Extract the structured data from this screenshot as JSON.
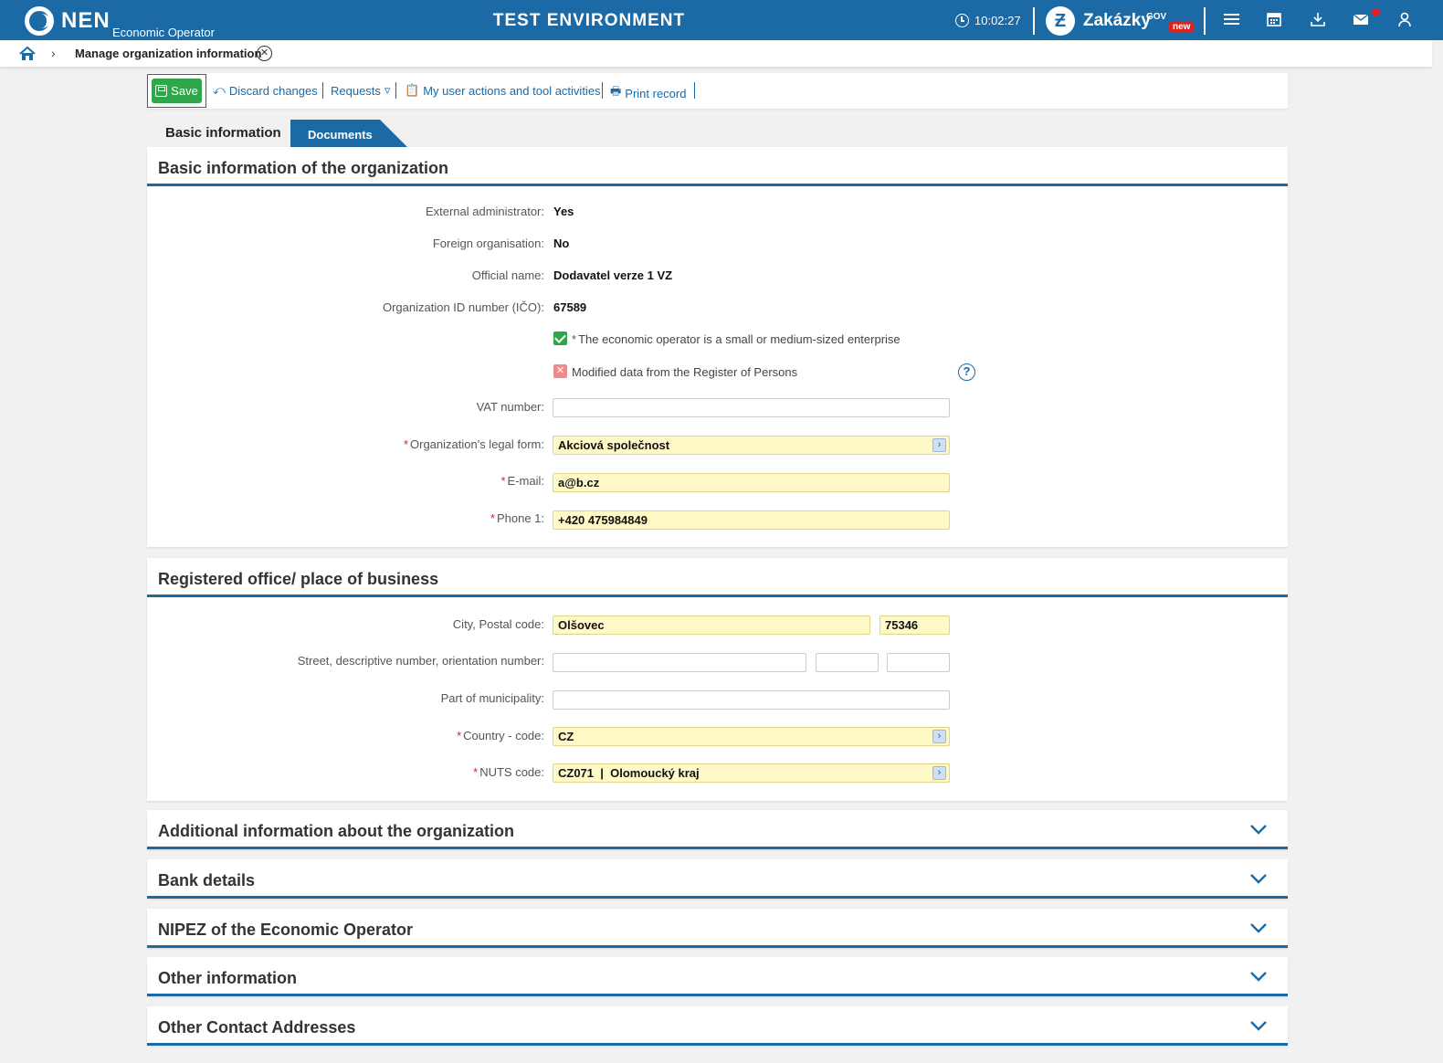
{
  "topbar": {
    "logo": "NEN",
    "logo_sub": "Economic Operator",
    "env_title": "TEST ENVIRONMENT",
    "time": "10:02:27",
    "zakazky": "Zakázky",
    "zakazky_gov": "GOV",
    "zakazky_new": "new",
    "icons": [
      "menu-icon",
      "calendar-icon",
      "download-icon",
      "mail-icon",
      "user-icon"
    ]
  },
  "breadcrumb": {
    "current": "Manage organization information"
  },
  "toolbar": {
    "save": "Save",
    "discard": "Discard changes",
    "requests": "Requests",
    "user_actions": "My user actions and tool activities",
    "print": "Print record"
  },
  "tabs": {
    "basic": "Basic information",
    "documents": "Documents"
  },
  "basic_section": {
    "title": "Basic information of the organization",
    "external_admin_label": "External administrator:",
    "external_admin_value": "Yes",
    "foreign_org_label": "Foreign organisation:",
    "foreign_org_value": "No",
    "official_name_label": "Official name:",
    "official_name_value": "Dodavatel verze 1 VZ",
    "ico_label": "Organization ID number (IČO):",
    "ico_value": "67589",
    "sme_label": "The economic operator is a small or medium-sized enterprise",
    "modified_label": "Modified data from the Register of Persons",
    "vat_label": "VAT number:",
    "vat_value": "",
    "legal_form_label": "Organization's legal form:",
    "legal_form_value": "Akciová společnost",
    "email_label": "E-mail:",
    "email_value": "a@b.cz",
    "phone_label": "Phone 1:",
    "phone_value": "+420 475984849"
  },
  "office_section": {
    "title": "Registered office/ place of business",
    "city_label": "City, Postal code:",
    "city_value": "Olšovec",
    "postal_value": "75346",
    "street_label": "Street, descriptive number, orientation number:",
    "part_label": "Part of municipality:",
    "country_label": "Country - code:",
    "country_value": "CZ",
    "nuts_label": "NUTS code:",
    "nuts_value": "CZ071  |  Olomoucký kraj"
  },
  "collapsed_sections": [
    "Additional information about the organization",
    "Bank details",
    "NIPEZ of the Economic Operator",
    "Other information",
    "Other Contact Addresses"
  ],
  "colors": {
    "primary": "#1b6aa5",
    "save_green": "#2fa64a",
    "required_field": "#fff9c8"
  }
}
